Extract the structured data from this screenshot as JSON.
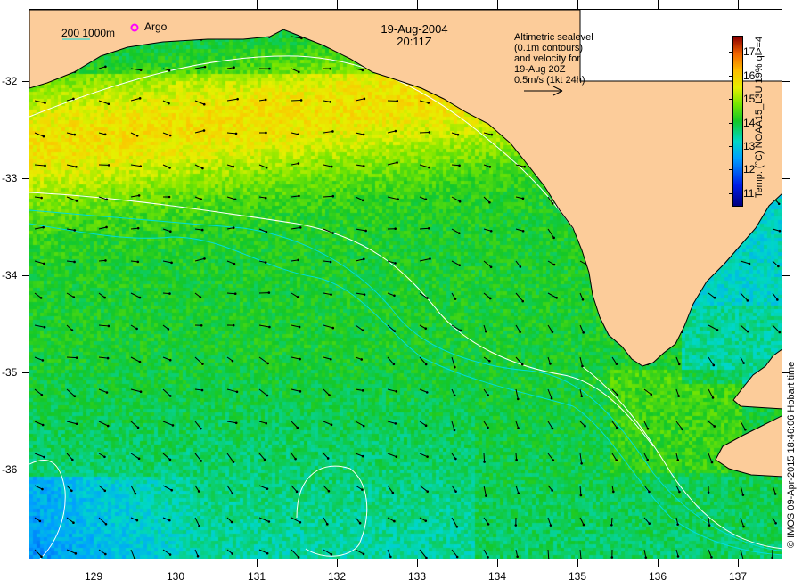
{
  "header": {
    "date": "19-Aug-2004",
    "time": "20:11Z"
  },
  "legend": {
    "isobaths": "200  1000m",
    "argo": "Argo",
    "argo_color": "#ff00ff",
    "isobath_color": "#00dddd"
  },
  "annotation": {
    "lines": [
      "Altimetric sealevel",
      "(0.1m contours)",
      "and velocity for",
      "19-Aug 20Z",
      "0.5m/s (1kt 24h)"
    ]
  },
  "colorbar": {
    "title": "Temp. (°C) NOAA15_L3U 19% ql>=4",
    "ticks": [
      "11",
      "12",
      "13",
      "14",
      "15",
      "16",
      "17"
    ],
    "range": [
      10.5,
      17.7
    ],
    "colormap": "jet"
  },
  "axes": {
    "lon_ticks": [
      "129",
      "130",
      "131",
      "132",
      "133",
      "134",
      "135",
      "136",
      "137"
    ],
    "lat_ticks": [
      "-32",
      "-33",
      "-34",
      "-35",
      "-36"
    ]
  },
  "credit": "© IMOS 09-Apr-2015 18:46:06 Hobart time",
  "colors": {
    "land": "#fccc9a",
    "contour": "#ffffff",
    "no_data": "#ffffff"
  }
}
